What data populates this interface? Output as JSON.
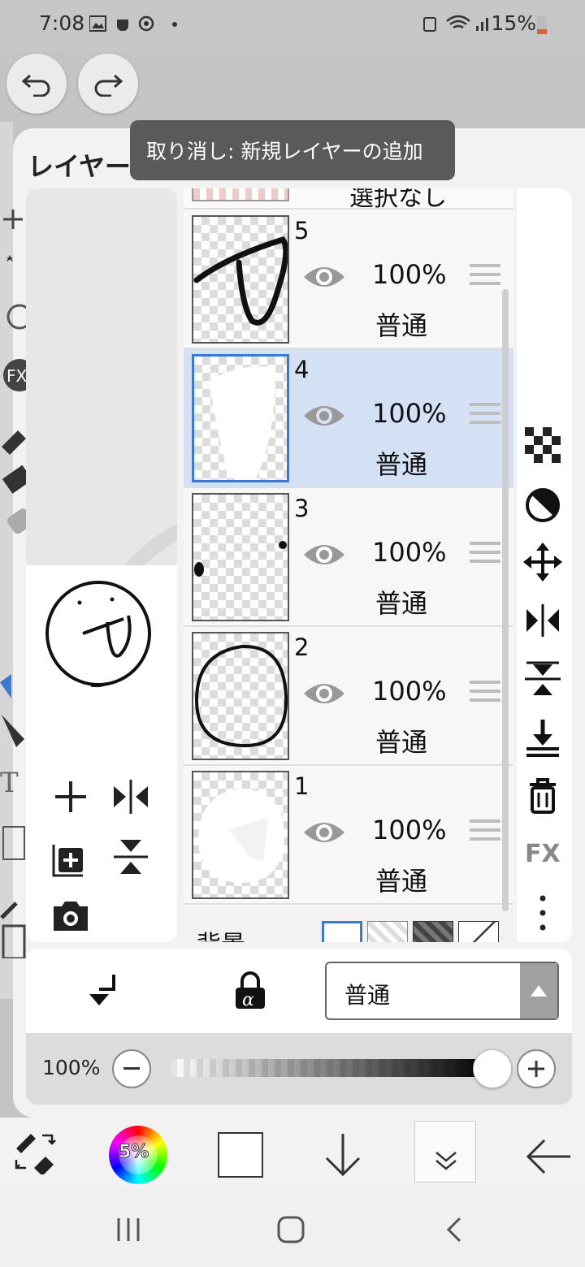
{
  "status_bar": {
    "time": "7:08",
    "battery": "15%"
  },
  "panel": {
    "title": "レイヤー"
  },
  "tooltip": {
    "text": "取り消し: 新規レイヤーの追加"
  },
  "layers_header": {
    "partial_label": "選択なし"
  },
  "layers": [
    {
      "number": "5",
      "opacity": "100%",
      "blend": "普通",
      "selected": false
    },
    {
      "number": "4",
      "opacity": "100%",
      "blend": "普通",
      "selected": true
    },
    {
      "number": "3",
      "opacity": "100%",
      "blend": "普通",
      "selected": false
    },
    {
      "number": "2",
      "opacity": "100%",
      "blend": "普通",
      "selected": false
    },
    {
      "number": "1",
      "opacity": "100%",
      "blend": "普通",
      "selected": false
    }
  ],
  "background_row": {
    "label": "背景"
  },
  "right_tools": {
    "icons": [
      "checker-icon",
      "contrast-icon",
      "move-icon",
      "flip-horizontal-icon",
      "flip-vertical-icon",
      "merge-down-icon",
      "trash-icon",
      "fx-icon",
      "more-vertical-icon"
    ],
    "fx_label": "FX"
  },
  "blend_select": {
    "value": "普通"
  },
  "opacity_slider": {
    "label": "100%",
    "value_percent": 100
  },
  "toolbar": {
    "color_label": "5%"
  },
  "colors": {
    "accent": "#3a7ad6",
    "selected_row": "#d4e1f4",
    "panel_bg": "#f2f2f2"
  }
}
